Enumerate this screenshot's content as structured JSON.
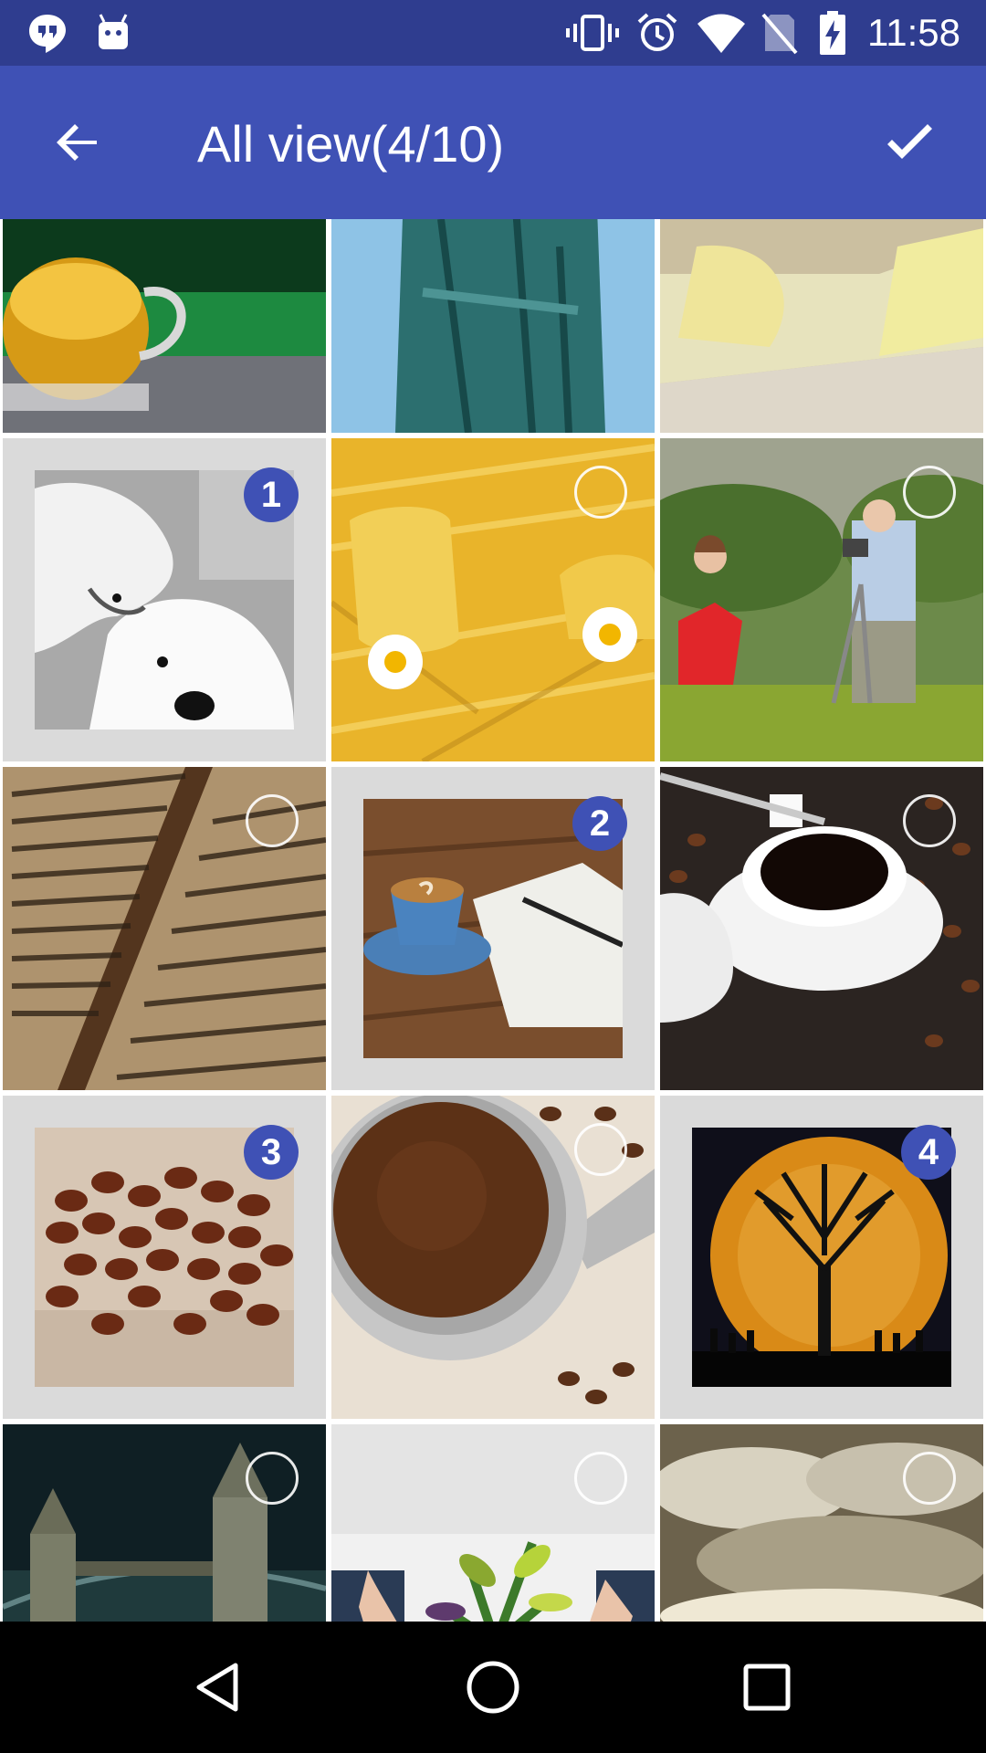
{
  "status_bar": {
    "time": "11:58",
    "icons": [
      "hangouts-icon",
      "android-icon",
      "vibrate-icon",
      "alarm-icon",
      "wifi-icon",
      "no-sim-icon",
      "battery-charging-icon"
    ]
  },
  "app_bar": {
    "title": "All view(4/10)",
    "back_icon": "arrow-back-icon",
    "done_icon": "checkmark-icon",
    "color": "#3f51b5"
  },
  "grid": {
    "columns": 3,
    "accent": "#3f51b5",
    "photos": [
      {
        "subject": "beer mug",
        "selected": false,
        "order": ""
      },
      {
        "subject": "statue",
        "selected": false,
        "order": ""
      },
      {
        "subject": "pasta closeup",
        "selected": false,
        "order": ""
      },
      {
        "subject": "polar bears",
        "selected": true,
        "order": "1"
      },
      {
        "subject": "pasta with daisies",
        "selected": false,
        "order": ""
      },
      {
        "subject": "children with camera",
        "selected": false,
        "order": ""
      },
      {
        "subject": "old book",
        "selected": false,
        "order": ""
      },
      {
        "subject": "coffee and notebook",
        "selected": true,
        "order": "2"
      },
      {
        "subject": "coffee cup with sugar",
        "selected": false,
        "order": ""
      },
      {
        "subject": "coffee beans",
        "selected": true,
        "order": "3"
      },
      {
        "subject": "ground coffee portafilter",
        "selected": false,
        "order": ""
      },
      {
        "subject": "tree at moon",
        "selected": true,
        "order": "4"
      },
      {
        "subject": "tower bridge",
        "selected": false,
        "order": ""
      },
      {
        "subject": "plant in hands",
        "selected": false,
        "order": ""
      },
      {
        "subject": "sea and clouds",
        "selected": false,
        "order": ""
      }
    ]
  },
  "nav_bar": {
    "icons": [
      "back-triangle-icon",
      "home-circle-icon",
      "recents-square-icon"
    ]
  }
}
